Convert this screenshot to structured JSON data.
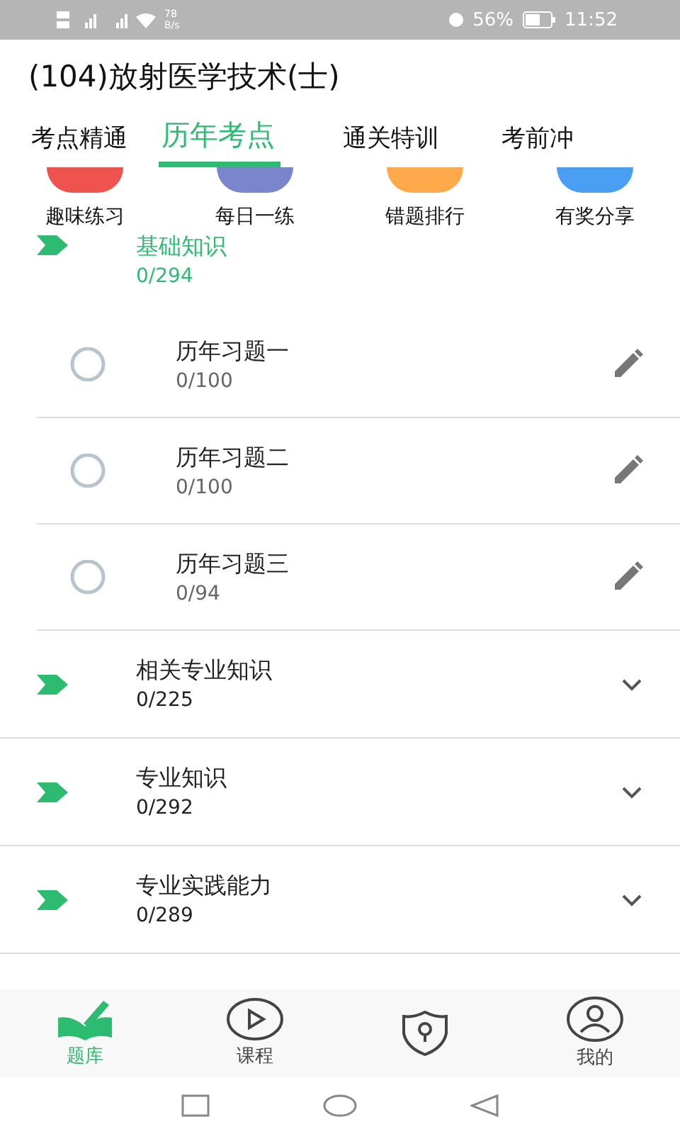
{
  "status_bar": {
    "speed": "78",
    "speed_unit": "B/s",
    "battery": "56%",
    "time": "11:52"
  },
  "title": "(104)放射医学技术(士)",
  "tabs": [
    {
      "label": "考点精通",
      "selected": false
    },
    {
      "label": "历年考点",
      "selected": true
    },
    {
      "label": "通关特训",
      "selected": false
    },
    {
      "label": "考前冲",
      "selected": false
    }
  ],
  "shortcuts": [
    {
      "label": "趣味练习",
      "color": "#ef5350"
    },
    {
      "label": "每日一练",
      "color": "#7986cb"
    },
    {
      "label": "错题排行",
      "color": "#ffa94d"
    },
    {
      "label": "有奖分享",
      "color": "#4a9ff5"
    }
  ],
  "sections": [
    {
      "title": "基础知识",
      "progress": "0/294",
      "expanded": true,
      "children": [
        {
          "title": "历年习题一",
          "progress": "0/100"
        },
        {
          "title": "历年习题二",
          "progress": "0/100"
        },
        {
          "title": "历年习题三",
          "progress": "0/94"
        }
      ]
    },
    {
      "title": "相关专业知识",
      "progress": "0/225",
      "expanded": false
    },
    {
      "title": "专业知识",
      "progress": "0/292",
      "expanded": false
    },
    {
      "title": "专业实践能力",
      "progress": "0/289",
      "expanded": false
    }
  ],
  "bottom_nav": [
    {
      "kind": "book",
      "label": "题库",
      "selected": true
    },
    {
      "kind": "play",
      "label": "课程",
      "selected": false
    },
    {
      "kind": "shield",
      "selected": false
    },
    {
      "kind": "user",
      "label": "我的",
      "selected": false
    }
  ]
}
